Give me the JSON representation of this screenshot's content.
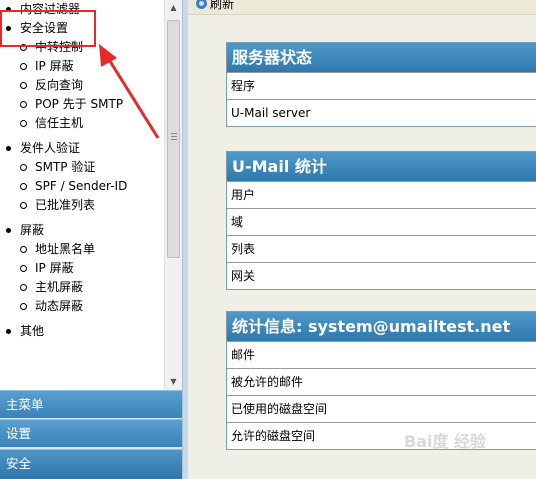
{
  "nav": {
    "items": [
      {
        "type": "group",
        "label": "内容过滤器"
      },
      {
        "type": "group",
        "label": "安全设置"
      },
      {
        "type": "sub",
        "label": "中转控制"
      },
      {
        "type": "sub",
        "label": "IP 屏蔽"
      },
      {
        "type": "sub",
        "label": "反向查询"
      },
      {
        "type": "sub",
        "label": "POP 先于 SMTP"
      },
      {
        "type": "sub",
        "label": "信任主机"
      },
      {
        "type": "group",
        "label": "发件人验证"
      },
      {
        "type": "sub",
        "label": "SMTP 验证"
      },
      {
        "type": "sub",
        "label": "SPF / Sender-ID"
      },
      {
        "type": "sub",
        "label": "已批准列表"
      },
      {
        "type": "group",
        "label": "屏蔽"
      },
      {
        "type": "sub",
        "label": "地址黑名单"
      },
      {
        "type": "sub",
        "label": "IP 屏蔽"
      },
      {
        "type": "sub",
        "label": "主机屏蔽"
      },
      {
        "type": "sub",
        "label": "动态屏蔽"
      },
      {
        "type": "group",
        "label": "其他"
      }
    ],
    "menus": [
      "主菜单",
      "设置",
      "安全"
    ]
  },
  "toolbar": {
    "refresh_label": "刷新"
  },
  "panels": {
    "server_status": {
      "title": "服务器状态",
      "rows": [
        "程序",
        "U-Mail server"
      ]
    },
    "umail_stats": {
      "title": "U-Mail 统计",
      "rows": [
        "用户",
        "域",
        "列表",
        "网关"
      ]
    },
    "account_stats": {
      "title": "统计信息: system@umailtest.net",
      "rows": [
        "邮件",
        "被允许的邮件",
        "已使用的磁盘空间",
        "允许的磁盘空间"
      ]
    }
  },
  "watermark": "Bai度 经验",
  "colors": {
    "accent": "#3a82b8",
    "highlight": "#e32b2b"
  }
}
